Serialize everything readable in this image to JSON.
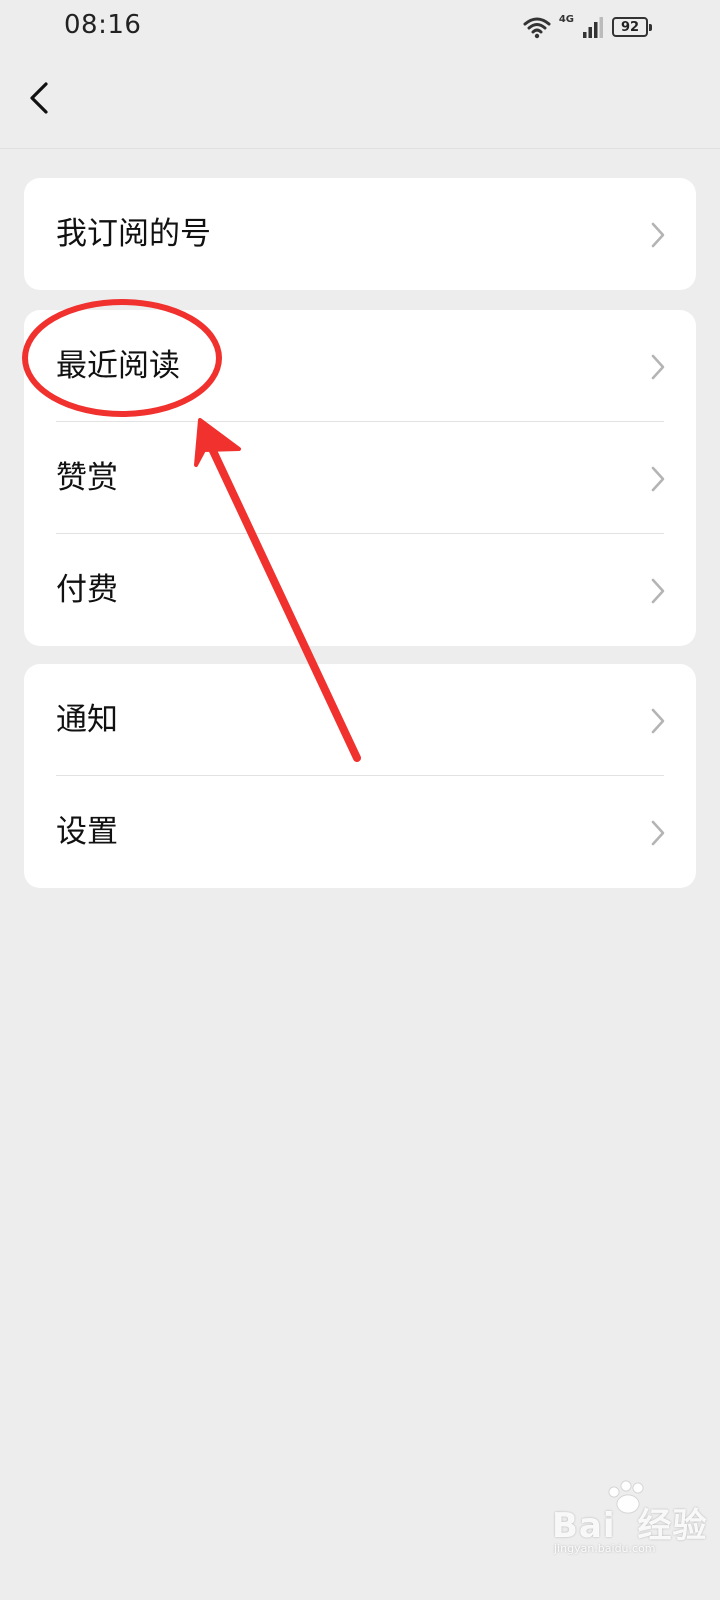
{
  "status_bar": {
    "time": "08:16",
    "network": "4G",
    "battery": "92",
    "icons": [
      "wifi-icon",
      "signal-icon",
      "battery-icon"
    ]
  },
  "nav": {
    "back_icon": "chevron-left-icon"
  },
  "groups": [
    {
      "items": [
        {
          "label": "我订阅的号"
        }
      ]
    },
    {
      "items": [
        {
          "label": "最近阅读"
        },
        {
          "label": "赞赏"
        },
        {
          "label": "付费"
        }
      ]
    },
    {
      "items": [
        {
          "label": "通知"
        },
        {
          "label": "设置"
        }
      ]
    }
  ],
  "annotation": {
    "color": "#f0312e",
    "target": "最近阅读"
  },
  "watermark": {
    "brand": "Bai",
    "suffix": "经验",
    "sub": "jingyan.baidu.com"
  },
  "colors": {
    "background": "#ededed",
    "card": "#ffffff",
    "divider": "#e2e2e2",
    "chevron": "#b4b4b4"
  }
}
